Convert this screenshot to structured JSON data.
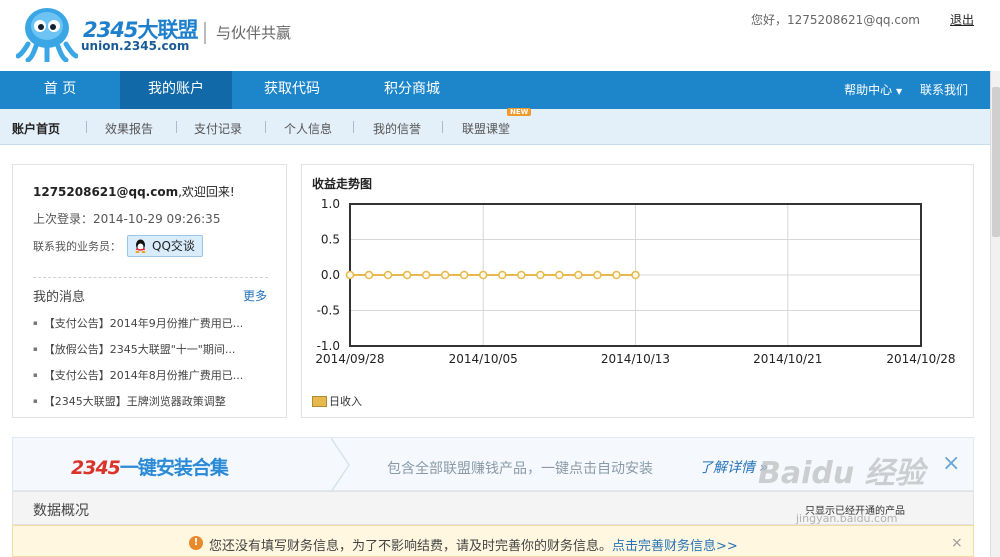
{
  "header": {
    "logo_brand": "2345",
    "logo_brand_cn": "大联盟",
    "logo_url": "union.2345.com",
    "slogan": "与伙伴共赢",
    "greeting": "您好，1275208621@qq.com",
    "logout_label": "退出"
  },
  "nav": {
    "items": [
      {
        "label": "首 页"
      },
      {
        "label": "我的账户"
      },
      {
        "label": "获取代码"
      },
      {
        "label": "积分商城"
      }
    ],
    "help_label": "帮助中心",
    "contact_label": "联系我们"
  },
  "subnav": {
    "items": [
      {
        "label": "账户首页"
      },
      {
        "label": "效果报告"
      },
      {
        "label": "支付记录"
      },
      {
        "label": "个人信息"
      },
      {
        "label": "我的信誉"
      },
      {
        "label": "联盟课堂"
      }
    ],
    "new_badge": "NEW"
  },
  "user": {
    "email": "1275208621@qq.com",
    "welcome": ",欢迎回来!",
    "last_login": "上次登录：2014-10-29 09:26:35",
    "contact_label": "联系我的业务员：",
    "qq_label": "QQ交谈"
  },
  "messages": {
    "title": "我的消息",
    "more_label": "更多",
    "items": [
      "【支付公告】2014年9月份推广费用已...",
      "【放假公告】2345大联盟\"十一\"期间...",
      "【支付公告】2014年8月份推广费用已...",
      "【2345大联盟】王牌浏览器政策调整"
    ]
  },
  "chart_data": {
    "type": "line",
    "title": "收益走势图",
    "x_tick_labels": [
      "2014/09/28",
      "2014/10/05",
      "2014/10/13",
      "2014/10/21",
      "2014/10/28"
    ],
    "y_tick_labels": [
      "1.0",
      "0.5",
      "0.0",
      "-0.5",
      "-1.0"
    ],
    "ylim": [
      -1.0,
      1.0
    ],
    "series": [
      {
        "name": "日收入",
        "color": "#e6b84e",
        "x": [
          "2014/09/28",
          "2014/09/29",
          "2014/09/30",
          "2014/10/01",
          "2014/10/02",
          "2014/10/03",
          "2014/10/04",
          "2014/10/05",
          "2014/10/06",
          "2014/10/07",
          "2014/10/08",
          "2014/10/09",
          "2014/10/10",
          "2014/10/11",
          "2014/10/12",
          "2014/10/13"
        ],
        "values": [
          0,
          0,
          0,
          0,
          0,
          0,
          0,
          0,
          0,
          0,
          0,
          0,
          0,
          0,
          0,
          0
        ]
      }
    ],
    "grid": true,
    "legend_position": "bottom-left"
  },
  "banner": {
    "logo_num": "2345",
    "logo_text": "一键安装合集",
    "text": "包含全部联盟赚钱产品，一键点击自动安装",
    "link_label": "了解详情 »",
    "close_icon": "×"
  },
  "data_overview": {
    "title": "数据概况",
    "filter_label": "只显示已经开通的产品"
  },
  "watermark": {
    "text": "Baidu 经验",
    "sub": "jingyan.baidu.com"
  },
  "notice": {
    "icon": "!",
    "text": "您还没有填写财务信息，为了不影响结费，请及时完善你的财务信息。",
    "link_label": "点击完善财务信息>>",
    "close_icon": "×"
  }
}
